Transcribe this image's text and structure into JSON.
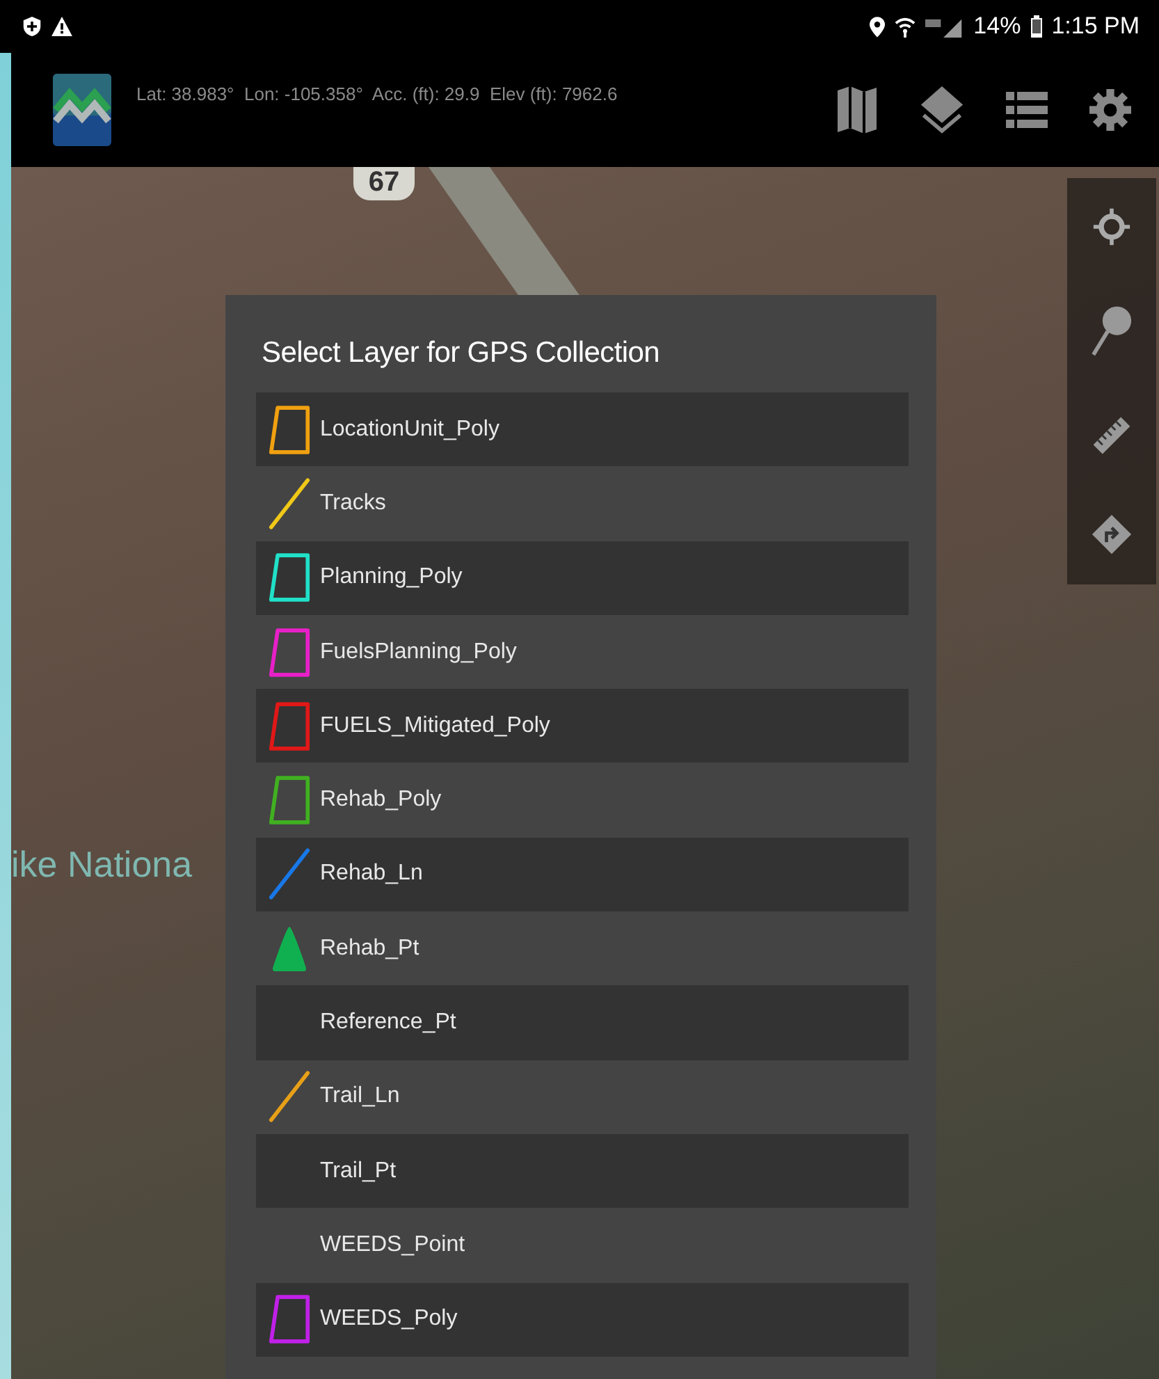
{
  "status_bar": {
    "battery": "14%",
    "time": "1:15 PM"
  },
  "app_bar": {
    "gps_readout": "Lat: 38.983°  Lon: -105.358°  Acc. (ft): 29.9  Elev (ft): 7962.6"
  },
  "map": {
    "route_shield": "67",
    "place_label": "ike Nationa"
  },
  "dialog": {
    "title": "Select Layer for GPS Collection",
    "layers": [
      {
        "name": "LocationUnit_Poly",
        "kind": "polygon",
        "color": "#f0a010"
      },
      {
        "name": "Tracks",
        "kind": "line",
        "color": "#f0c818"
      },
      {
        "name": "Planning_Poly",
        "kind": "polygon",
        "color": "#20e0c8"
      },
      {
        "name": "FuelsPlanning_Poly",
        "kind": "polygon",
        "color": "#e820c8"
      },
      {
        "name": "FUELS_Mitigated_Poly",
        "kind": "polygon",
        "color": "#e01818"
      },
      {
        "name": "Rehab_Poly",
        "kind": "polygon",
        "color": "#40b020"
      },
      {
        "name": "Rehab_Ln",
        "kind": "line",
        "color": "#1878e8"
      },
      {
        "name": "Rehab_Pt",
        "kind": "point",
        "color": "#10b050"
      },
      {
        "name": "Reference_Pt",
        "kind": "none"
      },
      {
        "name": "Trail_Ln",
        "kind": "line",
        "color": "#e8a018"
      },
      {
        "name": "Trail_Pt",
        "kind": "none"
      },
      {
        "name": "WEEDS_Point",
        "kind": "none"
      },
      {
        "name": "WEEDS_Poly",
        "kind": "polygon",
        "color": "#c020e8"
      }
    ]
  }
}
